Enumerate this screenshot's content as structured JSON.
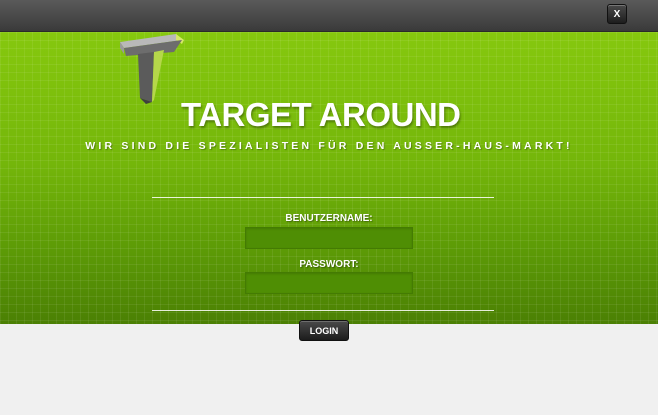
{
  "window": {
    "close_label": "X"
  },
  "header": {
    "brand": "TARGET AROUND",
    "tagline": "WIR SIND DIE SPEZIALISTEN FÜR DEN AUSSER-HAUS-MARKT!",
    "logo_icon": "t-letter-logo-icon"
  },
  "login_form": {
    "username_label": "BENUTZERNAME:",
    "username_value": "",
    "password_label": "PASSWORT:",
    "password_value": "",
    "submit_label": "LOGIN"
  },
  "colors": {
    "panel_green": "#74b60a",
    "panel_green_dark": "#4b8004",
    "input_green": "#4f8e04",
    "top_bar": "#4a4a4a",
    "page_background": "#f0f0f0"
  }
}
